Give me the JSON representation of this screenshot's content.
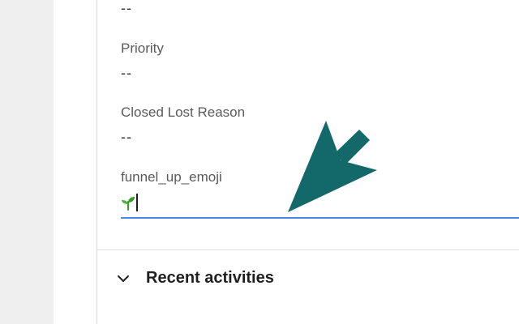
{
  "fields": [
    {
      "label": "",
      "value": "--"
    },
    {
      "label": "Priority",
      "value": "--"
    },
    {
      "label": "Closed Lost Reason",
      "value": "--"
    }
  ],
  "edit_field": {
    "label": "funnel_up_emoji",
    "value": "🌱"
  },
  "section": {
    "title": "Recent activities"
  },
  "colors": {
    "input_underline": "#4a86e8",
    "cursor_arrow": "#13696a",
    "sprout": "#3a9a2a"
  },
  "icons": {
    "chevron": "chevron-down-icon",
    "sprout": "seedling-icon",
    "arrow": "pointer-arrow-icon"
  }
}
